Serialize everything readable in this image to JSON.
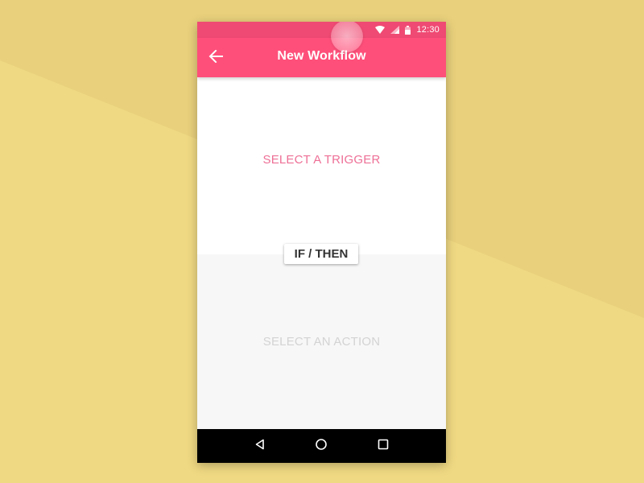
{
  "colors": {
    "background": "#E8D07C",
    "background_accent": "#F0D983",
    "status_bar": "#EF4A73",
    "app_bar": "#FE4F7A",
    "trigger_text": "#EE7097",
    "action_text": "#D3D3D3",
    "nav_bar": "#000000"
  },
  "status_bar": {
    "time": "12:30",
    "icons": [
      "wifi-icon",
      "signal-icon",
      "battery-icon"
    ]
  },
  "app_bar": {
    "title": "New Workflow",
    "back_icon": "arrow-back-icon"
  },
  "workflow": {
    "trigger_label": "SELECT A TRIGGER",
    "connector_label": "IF / THEN",
    "action_label": "SELECT AN ACTION"
  },
  "nav_bar": {
    "icons": [
      "back-triangle-icon",
      "home-circle-icon",
      "recents-square-icon"
    ]
  }
}
